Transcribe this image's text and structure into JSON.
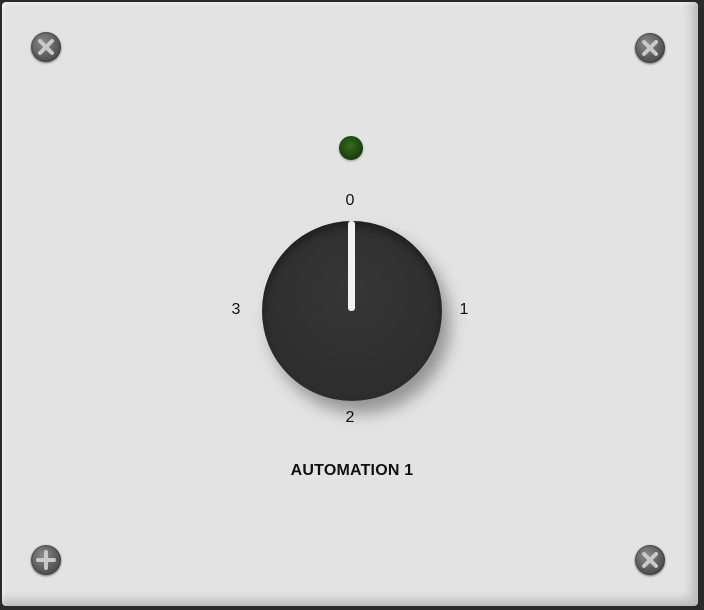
{
  "panel": {
    "title": "AUTOMATION 1",
    "led": {
      "state": "off",
      "color": "#1f4a10"
    },
    "knob": {
      "positions": [
        "0",
        "1",
        "2",
        "3"
      ],
      "selected": "0",
      "color": "#2f2f2f",
      "pointer_color": "#f2f2f2"
    }
  },
  "icons": {
    "screw": "phillips-screw-icon"
  }
}
